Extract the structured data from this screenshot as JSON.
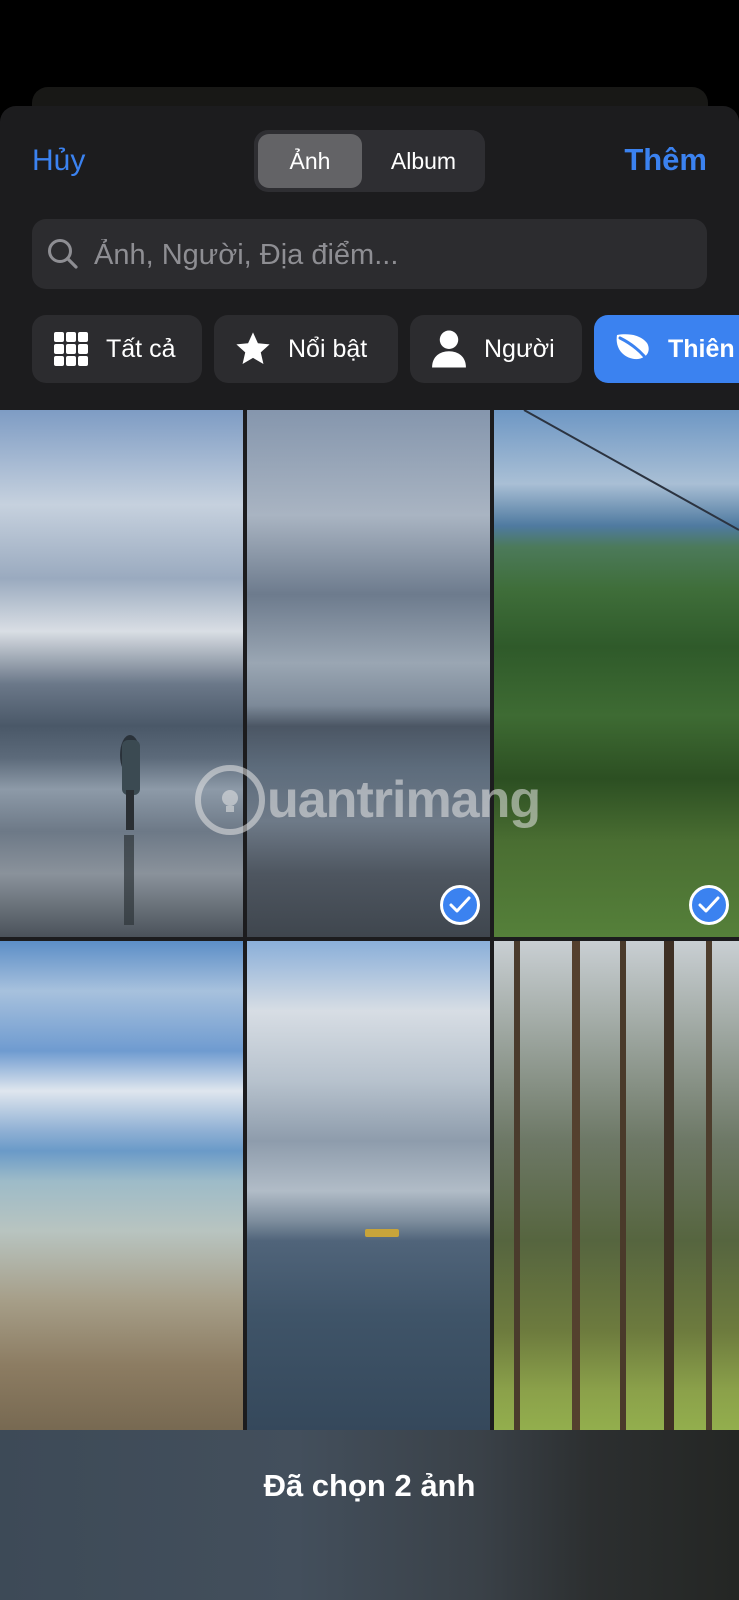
{
  "nav": {
    "cancel_label": "Hủy",
    "add_label": "Thêm",
    "segments": [
      {
        "label": "Ảnh",
        "active": true
      },
      {
        "label": "Album",
        "active": false
      }
    ]
  },
  "search": {
    "placeholder": "Ảnh, Người, Địa điểm...",
    "value": "",
    "icon": "search-icon"
  },
  "filters": [
    {
      "label": "Tất cả",
      "icon": "grid-icon",
      "active": false
    },
    {
      "label": "Nổi bật",
      "icon": "star-icon",
      "active": false
    },
    {
      "label": "Người",
      "icon": "person-icon",
      "active": false
    },
    {
      "label": "Thiên nhiên",
      "visible_label": "Thiên",
      "icon": "leaf-icon",
      "active": true
    }
  ],
  "photos": [
    {
      "subject": "woman on beach under cloudy sky",
      "selected": false
    },
    {
      "subject": "grey sea and clouds",
      "selected": true
    },
    {
      "subject": "green forest mountains",
      "selected": true
    },
    {
      "subject": "blue sky over shallow sea",
      "selected": false
    },
    {
      "subject": "clouds over open sea with boat",
      "selected": false
    },
    {
      "subject": "pine forest",
      "selected": false
    }
  ],
  "watermark": "uantrimang",
  "footer": {
    "selection_text": "Đã chọn 2 ảnh",
    "selected_count": 2
  },
  "colors": {
    "accent": "#3b82f0",
    "sheet_bg": "#1c1c1e",
    "chip_bg": "#2c2c2f"
  }
}
